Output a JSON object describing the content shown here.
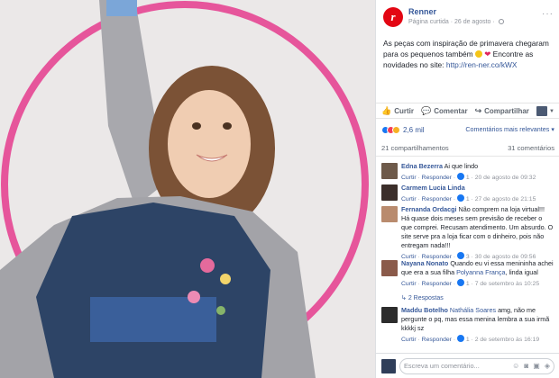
{
  "page": {
    "name": "Renner",
    "meta_line": "Página curtida · 26 de agosto ·",
    "logo_letter": "r",
    "brand_color": "#e30613"
  },
  "post": {
    "text_1": "As peças com inspiração de primavera chegaram para os pequenos também",
    "text_2": "Encontre as novidades no site:",
    "link": "http://ren-ner.co/kWX"
  },
  "actions": {
    "like": "Curtir",
    "comment": "Comentar",
    "share": "Compartilhar"
  },
  "reactions": {
    "count": "2,6 mil",
    "sort_label": "Comentários mais relevantes"
  },
  "stats": {
    "shares": "21 compartilhamentos",
    "comments": "31 comentários"
  },
  "comments": [
    {
      "author": "Edna Bezerra",
      "text": "Ai que lindo",
      "like": "Curtir",
      "reply": "Responder",
      "likes": "1",
      "date": "20 de agosto de 09:32",
      "avatar_color": "#6e5a4a"
    },
    {
      "author": "Carmem Lucia Linda",
      "text": "",
      "like": "Curtir",
      "reply": "Responder",
      "likes": "1",
      "date": "27 de agosto de 21:15",
      "avatar_color": "#3b2e2a"
    },
    {
      "author": "Fernanda Ordacgi",
      "text": "Não comprem na loja virtual!!! Há quase dois meses sem previsão de receber o que comprei. Recusam atendimento. Um absurdo. O site serve pra a loja ficar com o dinheiro, pois não entregam nada!!!",
      "like": "Curtir",
      "reply": "Responder",
      "likes": "3",
      "date": "30 de agosto de 09:56",
      "avatar_color": "#b98b6e"
    },
    {
      "author": "Nayana Nonato",
      "text": "Quando eu vi essa menininha achei que era a sua filha",
      "mention": "Polyanna França",
      "text_end": ", linda igual",
      "like": "Curtir",
      "reply": "Responder",
      "likes": "1",
      "date": "7 de setembro às 10:25",
      "replies": "2 Respostas",
      "avatar_color": "#8a5a4a"
    },
    {
      "author": "Maddu Botelho",
      "mention": "Nathália Soares",
      "text": "amg, não me pergunte o pq, mas essa menina lembra a sua irmã kkkkj sz",
      "like": "Curtir",
      "reply": "Responder",
      "likes": "1",
      "date": "2 de setembro às 16:19",
      "avatar_color": "#2c2c2c"
    }
  ],
  "write": {
    "placeholder": "Escreva um comentário..."
  }
}
